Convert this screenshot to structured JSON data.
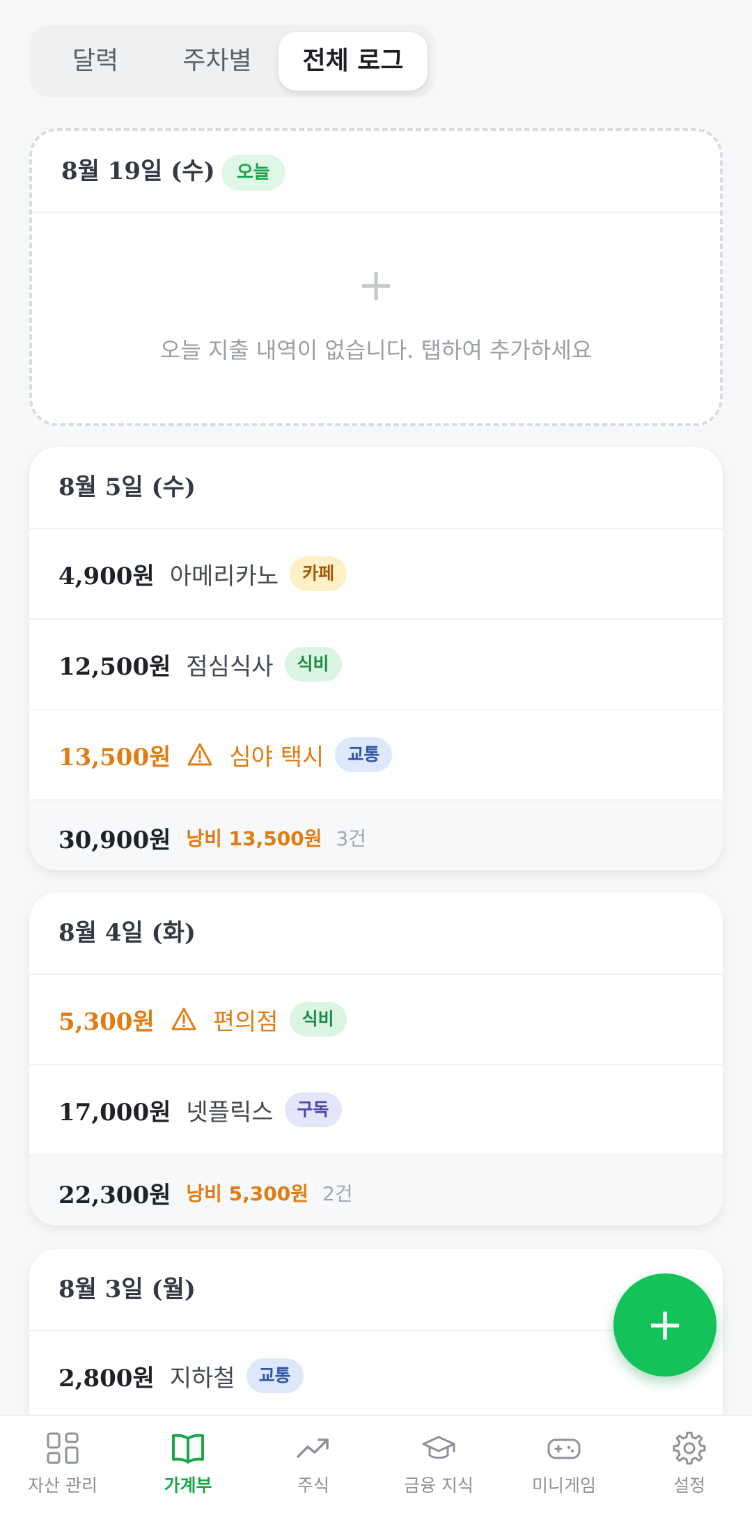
{
  "tabs": [
    {
      "label": "달력",
      "active": false
    },
    {
      "label": "주차별",
      "active": false
    },
    {
      "label": "전체 로그",
      "active": true
    }
  ],
  "today_card": {
    "date": "8월 19일 (수)",
    "badge": "오늘",
    "empty_icon": "+",
    "empty_text": "오늘 지출 내역이 없습니다. 탭하여 추가하세요"
  },
  "days": [
    {
      "date": "8월 5일 (수)",
      "items": [
        {
          "amount": "4,900원",
          "name": "아메리카노",
          "category": "카페",
          "warn": false
        },
        {
          "amount": "12,500원",
          "name": "점심식사",
          "category": "식비",
          "warn": false
        },
        {
          "amount": "13,500원",
          "name": "심야 택시",
          "category": "교통",
          "warn": true
        }
      ],
      "summary": {
        "total": "30,900원",
        "waste": "낭비 13,500원",
        "count": "3건"
      }
    },
    {
      "date": "8월 4일 (화)",
      "items": [
        {
          "amount": "5,300원",
          "name": "편의점",
          "category": "식비",
          "warn": true
        },
        {
          "amount": "17,000원",
          "name": "넷플릭스",
          "category": "구독",
          "warn": false
        }
      ],
      "summary": {
        "total": "22,300원",
        "waste": "낭비 5,300원",
        "count": "2건"
      }
    },
    {
      "date": "8월 3일 (월)",
      "items": [
        {
          "amount": "2,800원",
          "name": "지하철",
          "category": "교통",
          "warn": false
        }
      ]
    }
  ],
  "fab": {
    "label": "+",
    "icon": "plus-icon",
    "color": "#14c25a"
  },
  "bottom_nav": [
    {
      "label": "자산 관리",
      "icon": "grid-icon",
      "active": false
    },
    {
      "label": "가계부",
      "icon": "book-icon",
      "active": true
    },
    {
      "label": "주식",
      "icon": "trend-up-icon",
      "active": false
    },
    {
      "label": "금융 지식",
      "icon": "graduation-cap-icon",
      "active": false
    },
    {
      "label": "미니게임",
      "icon": "gamepad-icon",
      "active": false
    },
    {
      "label": "설정",
      "icon": "gear-icon",
      "active": false
    }
  ],
  "colors": {
    "accent": "#14c25a",
    "warning": "#e07c12"
  }
}
